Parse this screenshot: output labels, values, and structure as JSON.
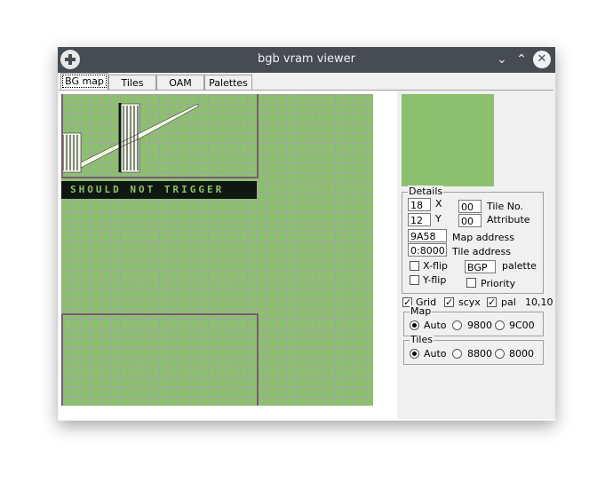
{
  "window": {
    "title": "bgb vram viewer"
  },
  "tabs": [
    {
      "label": "BG map",
      "active": true
    },
    {
      "label": "Tiles",
      "active": false
    },
    {
      "label": "OAM",
      "active": false
    },
    {
      "label": "Palettes",
      "active": false
    }
  ],
  "bgmap": {
    "banner_text": "SHOULD NOT TRIGGER",
    "tile_color": "#8cc06f",
    "grid_color": "#a3a3a3",
    "viewport_color": "#7a5a76"
  },
  "details": {
    "legend": "Details",
    "x_value": "18",
    "x_label": "X",
    "y_value": "12",
    "y_label": "Y",
    "tile_no_value": "00",
    "tile_no_label": "Tile No.",
    "attribute_value": "00",
    "attribute_label": "Attribute",
    "map_address_value": "9A58",
    "map_address_label": "Map address",
    "tile_address_value": "0:8000",
    "tile_address_label": "Tile address",
    "xflip_label": "X-flip",
    "yflip_label": "Y-flip",
    "palette_value": "BGP",
    "palette_label": "palette",
    "priority_label": "Priority"
  },
  "options": {
    "grid_label": "Grid",
    "scyx_label": "scyx",
    "pal_label": "pal",
    "coords": "10,10"
  },
  "map_group": {
    "legend": "Map",
    "options": [
      "Auto",
      "9800",
      "9C00"
    ],
    "selected": "Auto"
  },
  "tiles_group": {
    "legend": "Tiles",
    "options": [
      "Auto",
      "8800",
      "8000"
    ],
    "selected": "Auto"
  }
}
